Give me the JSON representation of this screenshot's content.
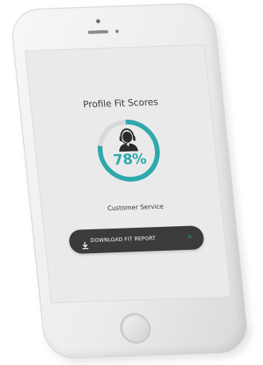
{
  "screen": {
    "title": "Profile Fit Scores",
    "score": {
      "value": 78,
      "label": "78%"
    },
    "role": "Customer Service",
    "download_button": {
      "label": "DOWNLOAD FIT REPORT",
      "icon": "download-icon",
      "trailing_icon": "chevron-right-icon"
    },
    "avatar_icon": "customer-service-agent-icon"
  },
  "colors": {
    "accent": "#2ea9ad",
    "button_bg": "#3b3b3b",
    "screen_bg": "#eaeaea",
    "ring_track": "#d9d9d9"
  }
}
